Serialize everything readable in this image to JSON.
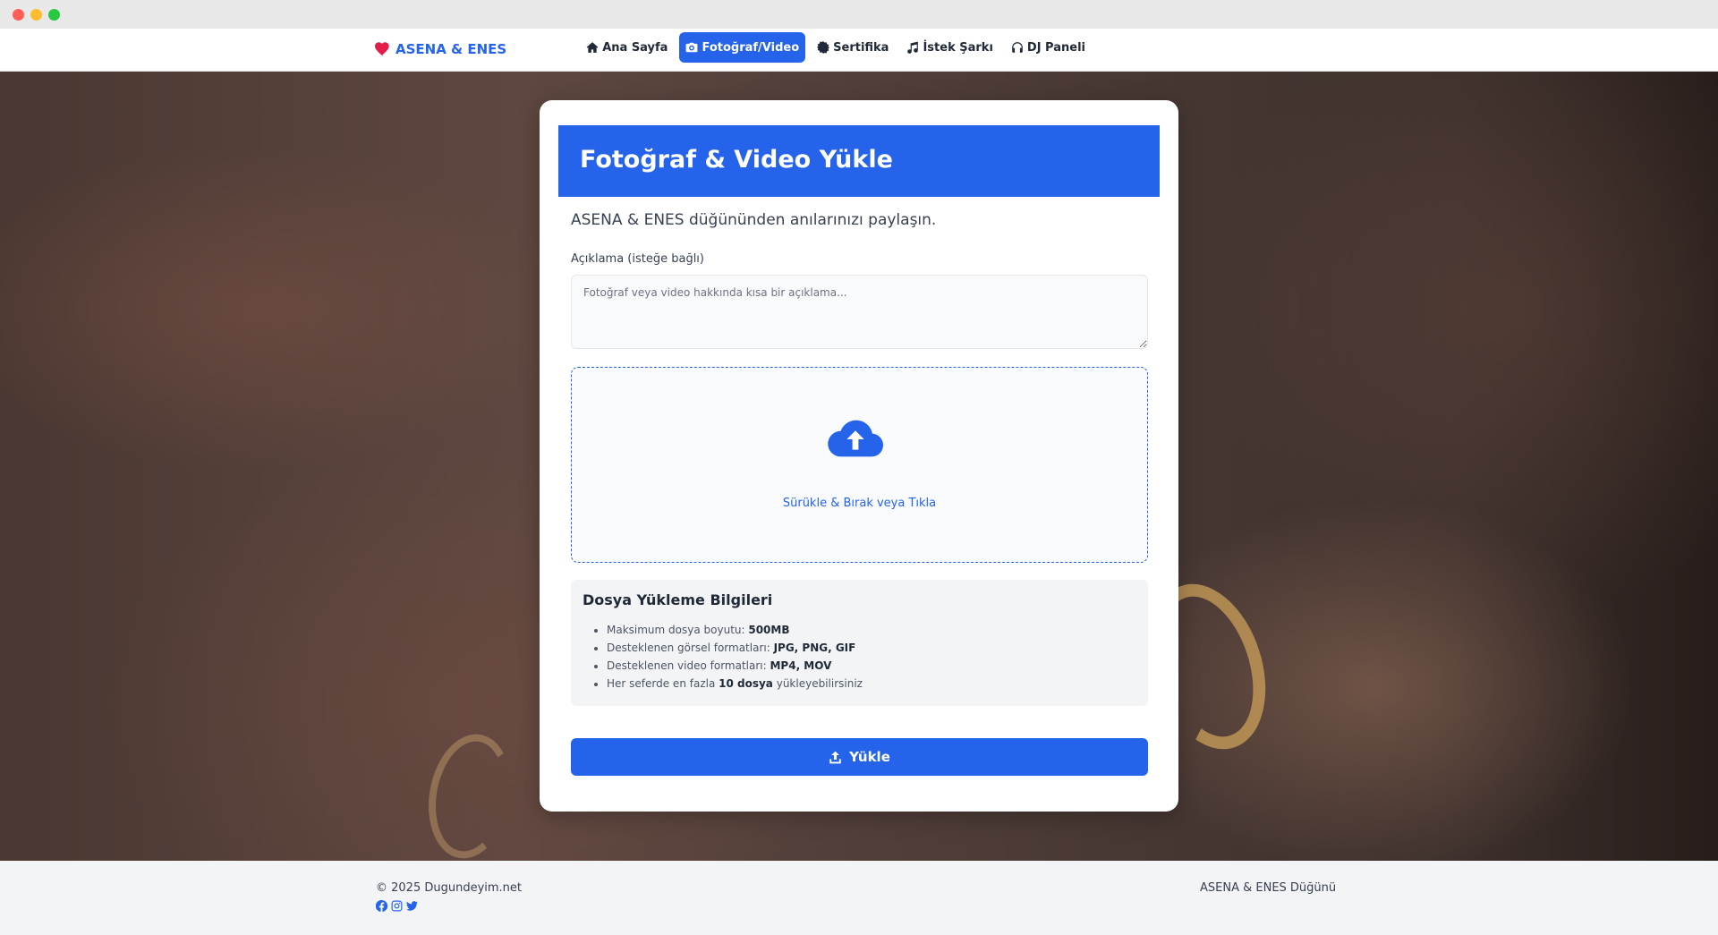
{
  "brand": {
    "name": "ASENA & ENES",
    "icon": "heart-icon",
    "color": "#2563eb",
    "icon_color": "#e11d48"
  },
  "nav": {
    "items": [
      {
        "label": "Ana Sayfa",
        "icon": "home-icon",
        "active": false
      },
      {
        "label": "Fotoğraf/Video",
        "icon": "camera-icon",
        "active": true
      },
      {
        "label": "Sertifika",
        "icon": "certificate-icon",
        "active": false
      },
      {
        "label": "İstek Şarkı",
        "icon": "music-icon",
        "active": false
      },
      {
        "label": "DJ Paneli",
        "icon": "headphones-icon",
        "active": false
      }
    ]
  },
  "upload": {
    "title": "Fotoğraf & Video Yükle",
    "subtitle": "ASENA & ENES düğününden anılarınızı paylaşın.",
    "description_label": "Açıklama (isteğe bağlı)",
    "description_placeholder": "Fotoğraf veya video hakkında kısa bir açıklama...",
    "description_value": "",
    "dropzone_icon": "cloud-upload-icon",
    "dropzone_text": "Sürükle & Bırak veya Tıkla",
    "info_title": "Dosya Yükleme Bilgileri",
    "info_items": [
      {
        "prefix": "Maksimum dosya boyutu: ",
        "bold": "500MB",
        "suffix": ""
      },
      {
        "prefix": "Desteklenen görsel formatları: ",
        "bold": "JPG, PNG, GIF",
        "suffix": ""
      },
      {
        "prefix": "Desteklenen video formatları: ",
        "bold": "MP4, MOV",
        "suffix": ""
      },
      {
        "prefix": "Her seferde en fazla ",
        "bold": "10 dosya",
        "suffix": " yükleyebilirsiniz"
      }
    ],
    "button_label": "Yükle",
    "button_icon": "upload-icon",
    "accent_color": "#2563eb"
  },
  "footer": {
    "copyright": "© 2025 Dugundeyim.net",
    "right_text": "ASENA & ENES Düğünü",
    "socials": [
      "facebook-icon",
      "instagram-icon",
      "twitter-icon"
    ]
  }
}
